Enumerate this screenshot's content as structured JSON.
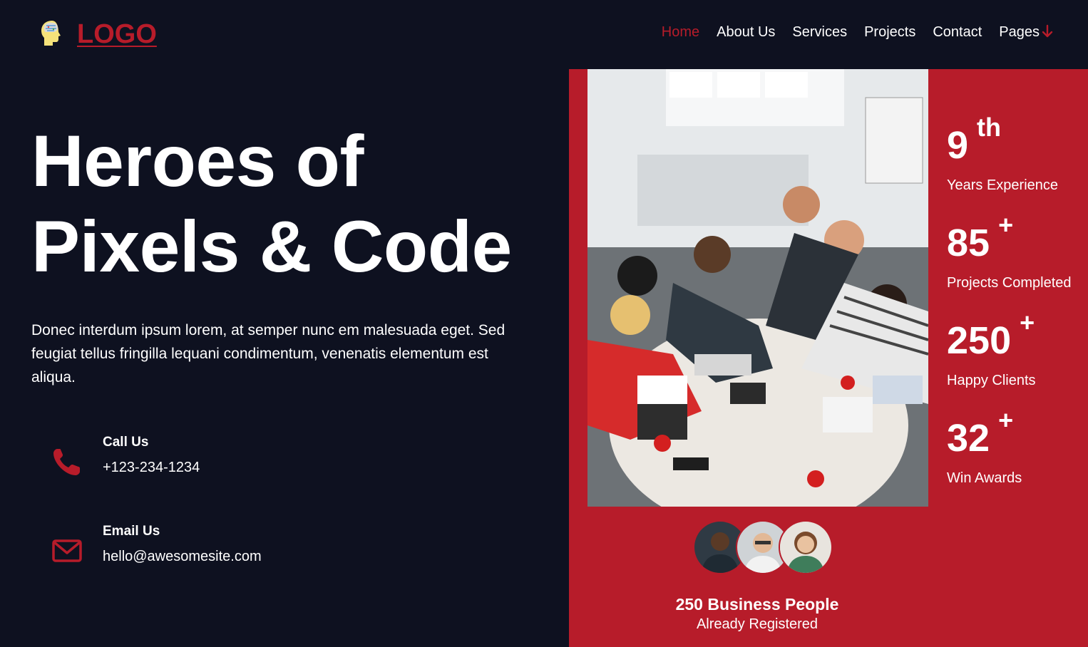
{
  "header": {
    "logo_text": "LOGO",
    "nav": [
      {
        "label": "Home",
        "active": true
      },
      {
        "label": "About Us"
      },
      {
        "label": "Services"
      },
      {
        "label": "Projects"
      },
      {
        "label": "Contact"
      },
      {
        "label": "Pages"
      }
    ]
  },
  "hero": {
    "title_line1": "Heroes of",
    "title_line2": "Pixels & Code",
    "description": "Donec interdum ipsum lorem, at semper nunc em malesuada eget. Sed feugiat tellus fringilla lequani condimentum, venenatis elementum est aliqua."
  },
  "contact": {
    "call": {
      "label": "Call Us",
      "value": "+123-234-1234",
      "icon": "phone-icon"
    },
    "email": {
      "label": "Email Us",
      "value": "hello@awesomesite.com",
      "icon": "envelope-icon"
    }
  },
  "stats": [
    {
      "value": "9",
      "suffix": "th",
      "label": "Years Experience"
    },
    {
      "value": "85",
      "suffix": "+",
      "label": "Projects Completed"
    },
    {
      "value": "250",
      "suffix": "+",
      "label": "Happy Clients"
    },
    {
      "value": "32",
      "suffix": "+",
      "label": "Win Awards"
    }
  ],
  "business": {
    "title": "250 Business People",
    "subtitle": "Already Registered"
  },
  "colors": {
    "background": "#0e1120",
    "accent": "#b71c2a",
    "text": "#ffffff"
  }
}
